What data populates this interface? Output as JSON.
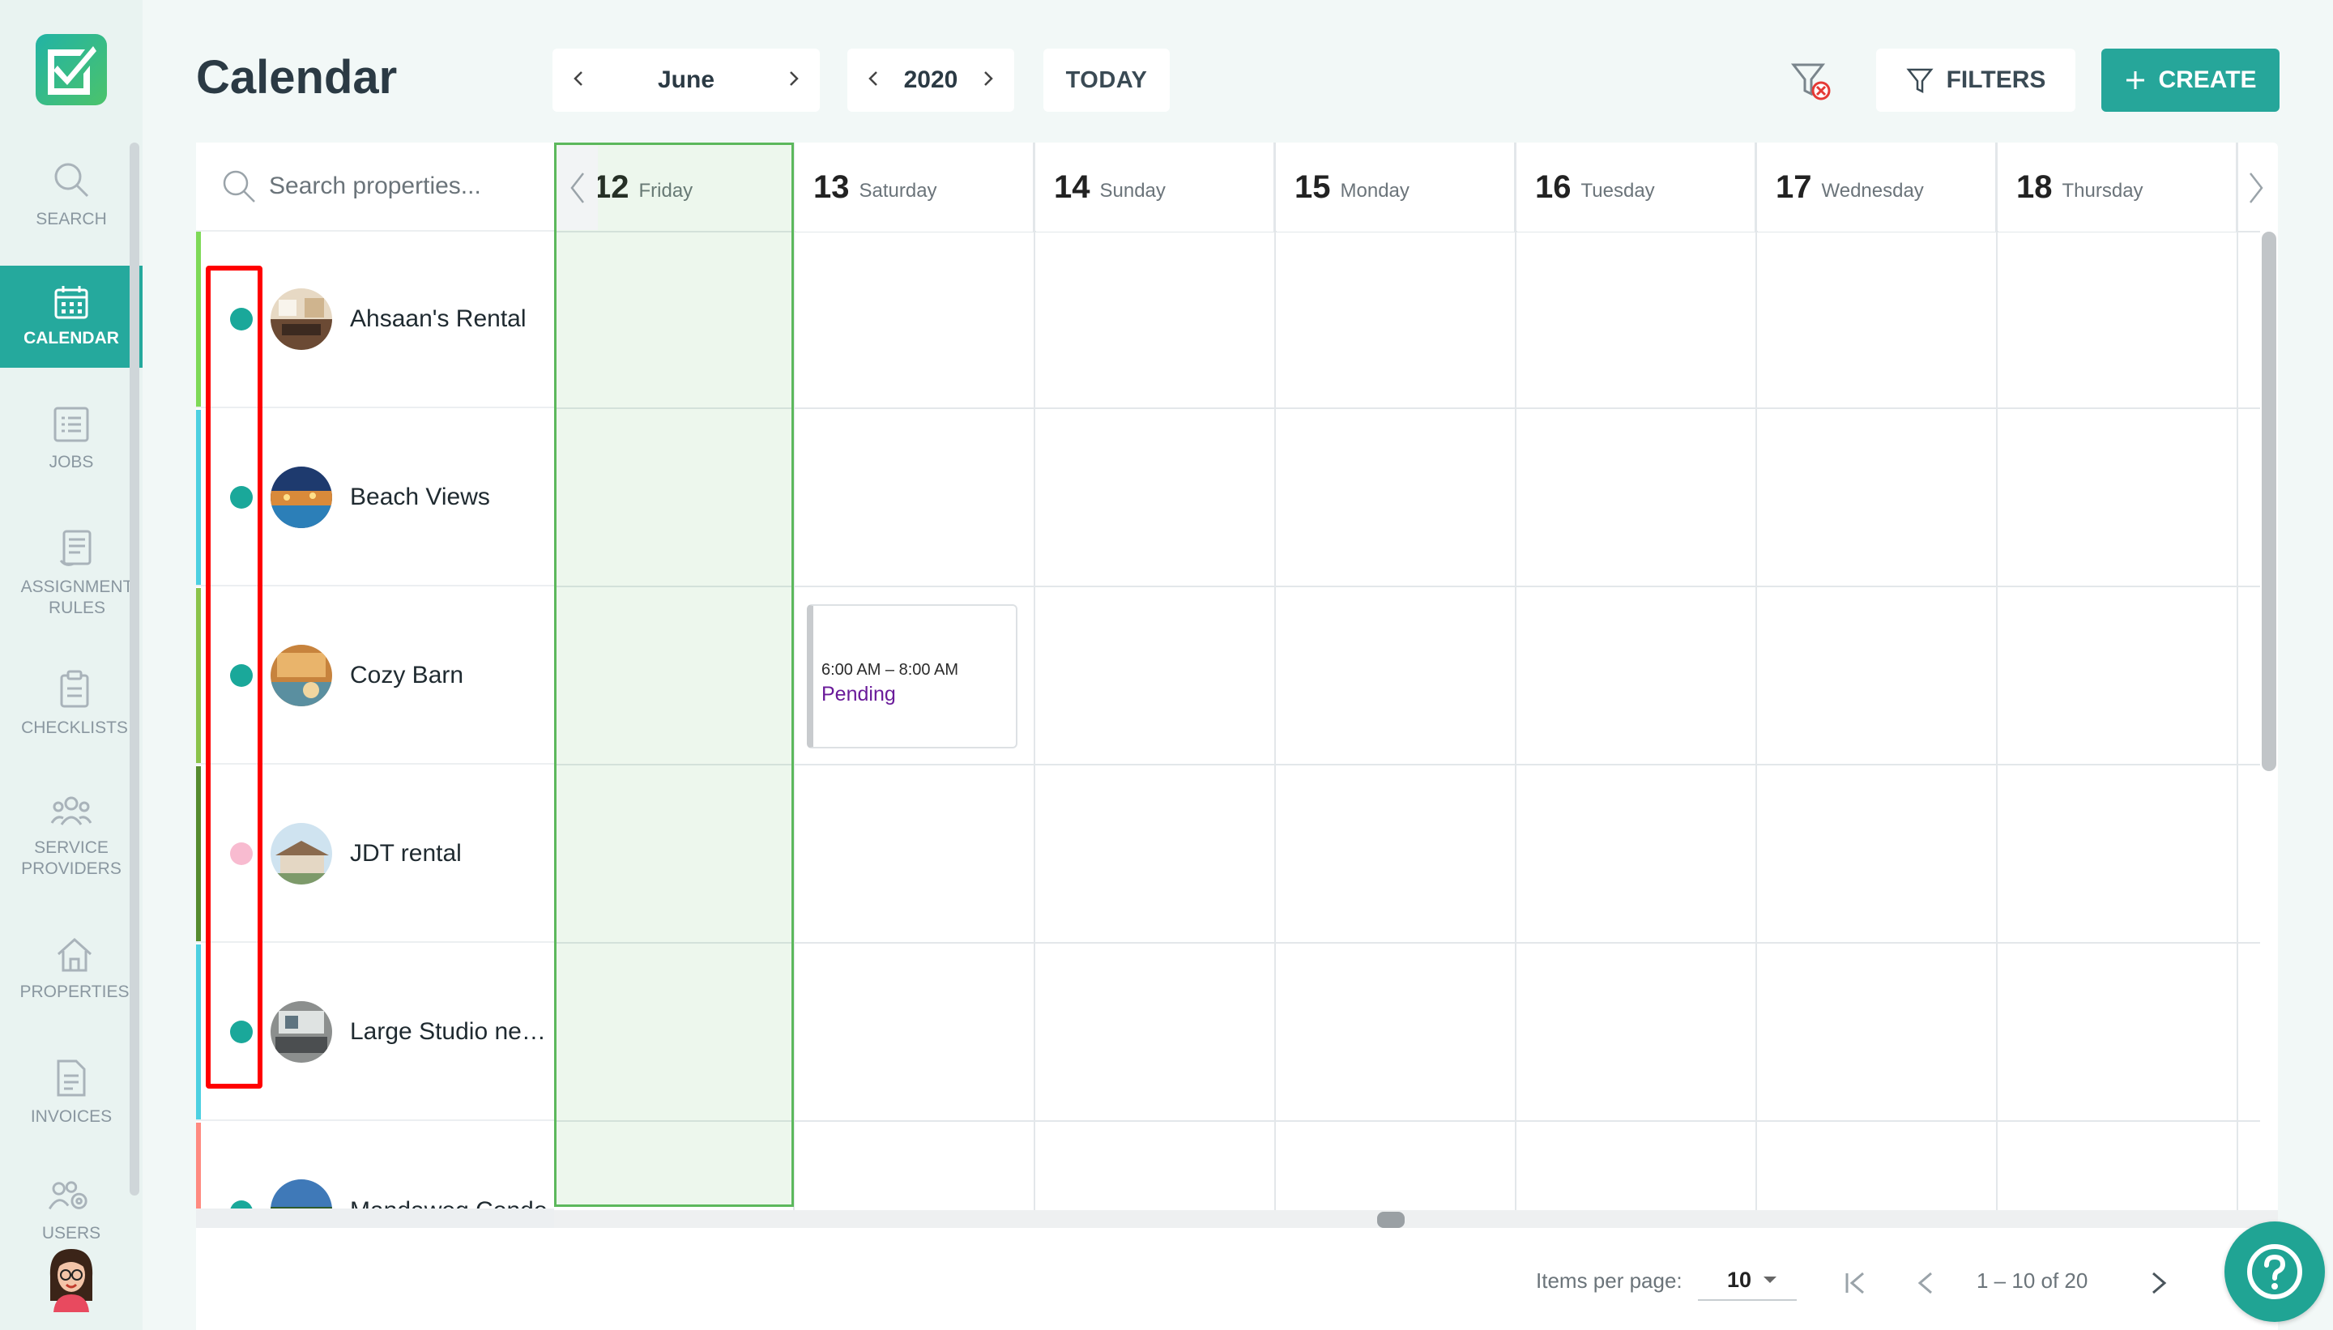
{
  "app": {
    "page_title": "Calendar"
  },
  "sidebar": {
    "items": [
      {
        "label": "SEARCH",
        "icon": "search-icon"
      },
      {
        "label": "CALENDAR",
        "icon": "calendar-icon",
        "active": true
      },
      {
        "label": "JOBS",
        "icon": "list-icon"
      },
      {
        "label": "ASSIGNMENT RULES",
        "icon": "document-icon"
      },
      {
        "label": "CHECKLISTS",
        "icon": "clipboard-icon"
      },
      {
        "label": "SERVICE PROVIDERS",
        "icon": "people-icon"
      },
      {
        "label": "PROPERTIES",
        "icon": "home-icon"
      },
      {
        "label": "INVOICES",
        "icon": "invoice-icon"
      },
      {
        "label": "USERS",
        "icon": "users-gear-icon"
      }
    ]
  },
  "header": {
    "month": "June",
    "year": "2020",
    "today_label": "TODAY",
    "filters_label": "FILTERS",
    "create_label": "CREATE"
  },
  "search": {
    "placeholder": "Search properties..."
  },
  "days": [
    {
      "num": "12",
      "name": "Friday",
      "today": true
    },
    {
      "num": "13",
      "name": "Saturday"
    },
    {
      "num": "14",
      "name": "Sunday"
    },
    {
      "num": "15",
      "name": "Monday"
    },
    {
      "num": "16",
      "name": "Tuesday"
    },
    {
      "num": "17",
      "name": "Wednesday"
    },
    {
      "num": "18",
      "name": "Thursday"
    }
  ],
  "properties": [
    {
      "name": "Ahsaan's Rental",
      "status_color": "#1aa89a",
      "bar_color": "#7ed957"
    },
    {
      "name": "Beach Views",
      "status_color": "#1aa89a",
      "bar_color": "#4dd0e1"
    },
    {
      "name": "Cozy Barn",
      "status_color": "#1aa89a",
      "bar_color": "#8bc34a"
    },
    {
      "name": "JDT rental",
      "status_color": "#f8bbd0",
      "bar_color": "#558b2f"
    },
    {
      "name": "Large Studio near Beach",
      "status_color": "#1aa89a",
      "bar_color": "#4dd0e1"
    },
    {
      "name": "Mandaweg Condo",
      "status_color": "#1aa89a",
      "bar_color": "#ff8a80"
    }
  ],
  "event": {
    "time": "6:00 AM – 8:00 AM",
    "status": "Pending",
    "status_color": "#6a1b9a"
  },
  "pagination": {
    "items_per_page_label": "Items per page:",
    "items_per_page": "10",
    "range": "1 – 10 of 20"
  },
  "colors": {
    "accent": "#26a69a",
    "today_border": "#5cb85c",
    "highlight": "#ff0000"
  }
}
